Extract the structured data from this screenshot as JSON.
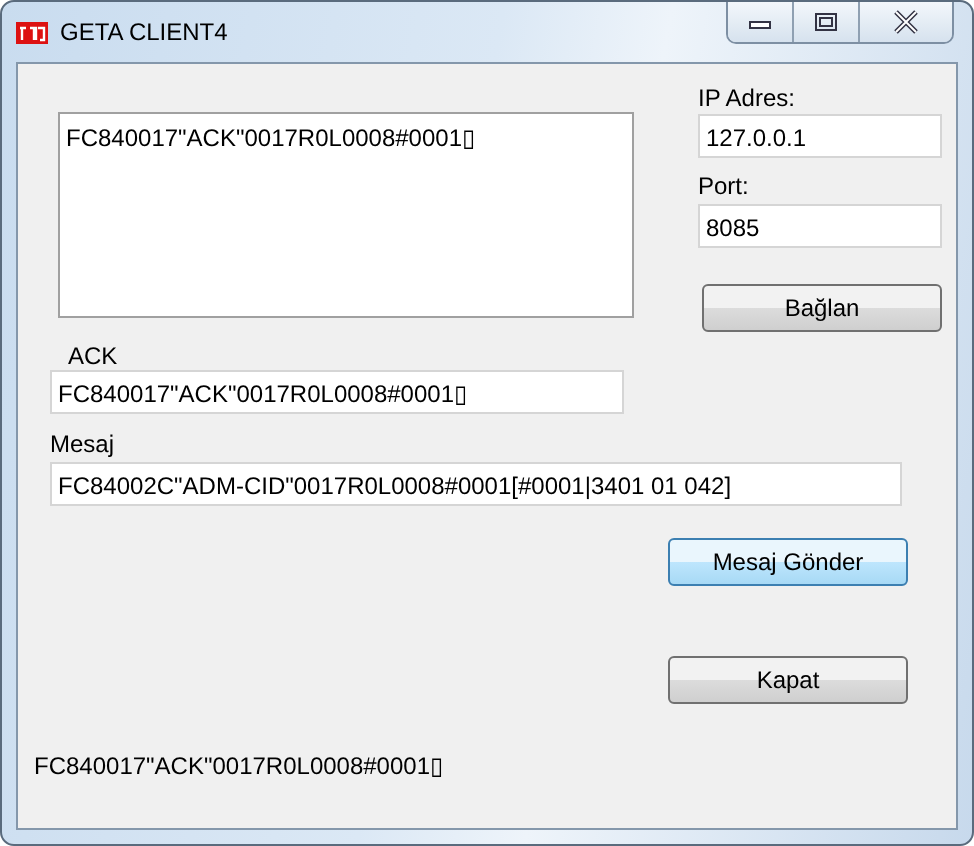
{
  "window": {
    "title": "GETA CLIENT4"
  },
  "received_log": {
    "lines": [
      "FC840017\"ACK\"0017R0L0008#0001▯"
    ]
  },
  "ip": {
    "label": "IP Adres:",
    "value": "127.0.0.1"
  },
  "port": {
    "label": "Port:",
    "value": "8085"
  },
  "connect_button": {
    "label": "Bağlan"
  },
  "ack": {
    "label": "ACK",
    "value": "FC840017\"ACK\"0017R0L0008#0001▯"
  },
  "message": {
    "label": "Mesaj",
    "value": "FC84002C\"ADM-CID\"0017R0L0008#0001[#0001|3401 01 042]"
  },
  "buttons": [
    {
      "label": "Mesaj Gönder",
      "focused": true
    },
    {
      "label": "Kapat",
      "focused": false
    }
  ],
  "status_text": "FC840017\"ACK\"0017R0L0008#0001▯"
}
